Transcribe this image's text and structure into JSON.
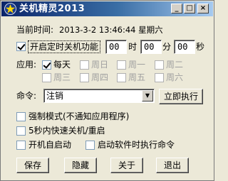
{
  "window": {
    "title": "关机精灵2013",
    "minimize_glyph": "_",
    "maximize_glyph": "□",
    "close_glyph": "×"
  },
  "current_time": {
    "label": "当前时间:",
    "value": "2013-3-2 13:46:44 星期六"
  },
  "timer": {
    "enable_label": "开启定时关机功能",
    "enabled": true,
    "hour": "00",
    "hour_unit": "时",
    "minute": "00",
    "minute_unit": "分",
    "second": "00",
    "second_unit": "秒"
  },
  "apply": {
    "label": "应用:",
    "days": [
      {
        "label": "每天",
        "checked": true,
        "enabled": true
      },
      {
        "label": "周日",
        "checked": false,
        "enabled": false
      },
      {
        "label": "周一",
        "checked": false,
        "enabled": false
      },
      {
        "label": "周二",
        "checked": false,
        "enabled": false
      },
      {
        "label": "周三",
        "checked": false,
        "enabled": false
      },
      {
        "label": "周四",
        "checked": false,
        "enabled": false
      },
      {
        "label": "周五",
        "checked": false,
        "enabled": false
      },
      {
        "label": "周六",
        "checked": false,
        "enabled": false
      }
    ]
  },
  "command": {
    "label": "命令:",
    "selected": "注销",
    "execute_button": "立即执行"
  },
  "options": [
    {
      "label": "强制模式(不通知应用程序)",
      "checked": false
    },
    {
      "label": "5秒内快速关机/重启",
      "checked": false
    },
    {
      "label": "开机自启动",
      "checked": false
    },
    {
      "label": "启动软件时执行命令",
      "checked": false
    }
  ],
  "buttons": {
    "save": "保存",
    "hide": "隐藏",
    "about": "关于",
    "exit": "退出"
  },
  "colors": {
    "titlebar_start": "#0a246a",
    "titlebar_end": "#a6caf0",
    "dialog_bg": "#ece9d8"
  }
}
